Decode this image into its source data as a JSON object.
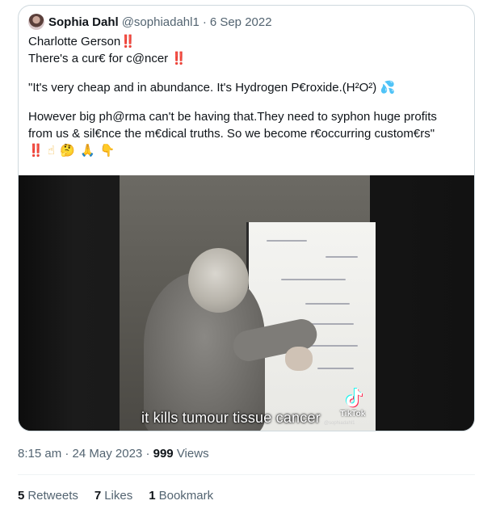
{
  "quoted_tweet": {
    "author_name": "Sophia Dahl",
    "author_handle": "@sophiadahl1",
    "separator": "·",
    "date": "6 Sep 2022",
    "lines": {
      "line1_text": "Charlotte Gerson",
      "line1_emoji": "‼️",
      "line2_text": "There's a cur€ for c@ncer",
      "line2_emoji": "‼️",
      "line3_text": "\"It's very cheap and in abundance. It's Hydrogen P€roxide.(H²O²)",
      "line3_emoji": "💦",
      "line4_text": "However big ph@rma can't be having that.They need to syphon huge profits",
      "line5_text": "from us & sil€nce the m€dical truths. So we become r€occurring custom€rs\"",
      "emoji_row": [
        "‼️",
        "☝",
        "🤔",
        "🙏",
        "👇"
      ]
    },
    "video": {
      "caption": "it kills tumour tissue cancer",
      "tiktok_label": "TikTok",
      "tiktok_handle": "@sophiadahl1"
    }
  },
  "tweet_meta": {
    "time": "8:15 am",
    "separator1": "·",
    "date": "24 May 2023",
    "separator2": "·",
    "views_count": "999",
    "views_label": "Views"
  },
  "engagement": {
    "retweets_count": "5",
    "retweets_label": "Retweets",
    "likes_count": "7",
    "likes_label": "Likes",
    "bookmarks_count": "1",
    "bookmarks_label": "Bookmark"
  }
}
